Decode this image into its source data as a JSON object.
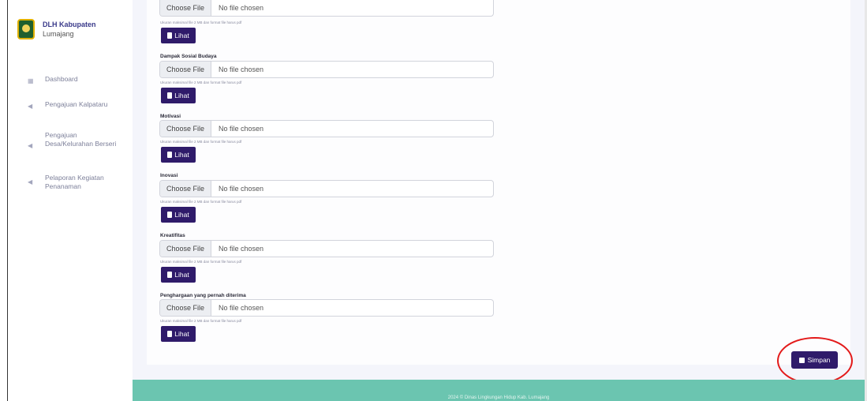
{
  "brand": {
    "name": "DLH Kabupaten",
    "sub": "Lumajang"
  },
  "sidebar": {
    "items": [
      {
        "label": "Dashboard",
        "icon": "dashboard-icon"
      },
      {
        "label": "Pengajuan Kalpataru",
        "icon": "send-icon"
      },
      {
        "label": "Pengajuan Desa/Kelurahan Berseri",
        "icon": "send-icon"
      },
      {
        "label": "Pelaporan Kegiatan Penanaman",
        "icon": "send-icon"
      }
    ]
  },
  "upload": {
    "choose_label": "Choose File",
    "empty_text": "No file chosen",
    "hint": "Ukuran maksimal file 2 MB dan format file harus pdf",
    "view_label": "Lihat",
    "fields": [
      {
        "label": ""
      },
      {
        "label": "Dampak Sosial Budaya"
      },
      {
        "label": "Motivasi"
      },
      {
        "label": "Inovasi"
      },
      {
        "label": "Kreatifitas"
      },
      {
        "label": "Penghargaan yang pernah diterima"
      }
    ]
  },
  "actions": {
    "save_label": "Simpan"
  },
  "footer": {
    "text": "2024 © Dinas Lingkungan Hidup Kab. Lumajang"
  },
  "colors": {
    "primary": "#2f1b6a",
    "footer": "#6bc5b0",
    "highlight": "#e31a1a"
  }
}
